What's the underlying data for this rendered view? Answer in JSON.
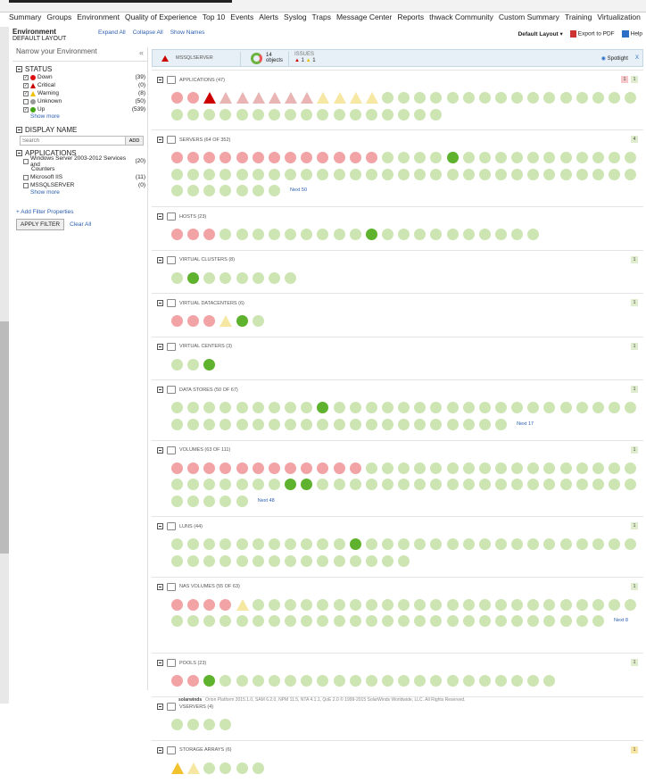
{
  "nav": [
    "Summary",
    "Groups",
    "Environment",
    "Quality of Experience",
    "Top 10",
    "Events",
    "Alerts",
    "Syslog",
    "Traps",
    "Message Center",
    "Reports",
    "thwack Community",
    "Custom Summary",
    "Training",
    "Virtualization"
  ],
  "page": {
    "title": "Environment",
    "subtitle": "DEFAULT LAYOUT",
    "expand_all": "Expand All",
    "collapse_all": "Collapse All",
    "show_names": "Show Names",
    "default_layout": "Default Layout",
    "export_pdf": "Export to PDF",
    "help": "Help"
  },
  "sidebar": {
    "narrow": "Narrow your Environment",
    "status_title": "STATUS",
    "status": [
      {
        "label": "Down",
        "count": "(39)",
        "color": "#dd1111",
        "checked": true,
        "shape": "circle"
      },
      {
        "label": "Critical",
        "count": "(0)",
        "color": "#cc0000",
        "checked": true,
        "shape": "triangle"
      },
      {
        "label": "Warning",
        "count": "(8)",
        "color": "#f0c000",
        "checked": true,
        "shape": "triangle"
      },
      {
        "label": "Unknown",
        "count": "(50)",
        "color": "#999999",
        "checked": false,
        "shape": "circle"
      },
      {
        "label": "Up",
        "count": "(539)",
        "color": "#44a414",
        "checked": true,
        "shape": "circle"
      }
    ],
    "show_more": "Show more",
    "display_name_title": "DISPLAY NAME",
    "search_placeholder": "Search",
    "search_btn": "ADD",
    "applications_title": "APPLICATIONS",
    "applications": [
      {
        "label": "Windows Server 2003-2012 Services and",
        "count": "(20)"
      },
      {
        "label": "Counters",
        "count": ""
      },
      {
        "label": "Microsoft IIS",
        "count": "(11)"
      },
      {
        "label": "MSSQLSERVER",
        "count": "(0)"
      }
    ],
    "add_filter": "+ Add Filter Properties",
    "apply": "APPLY FILTER",
    "clear": "Clear All"
  },
  "banner": {
    "node": "MSSQLSERVER",
    "objects_count": "14",
    "objects_label": "objects",
    "issues_label": "ISSUES",
    "crit_count": "1",
    "warn_count": "1",
    "spotlight": "Spotlight",
    "close": "X"
  },
  "groups": [
    {
      "title": "APPLICATIONS (47)",
      "badges": [
        "1",
        "1"
      ],
      "dots": "rrRwwwwwwyyyyggggggggggggggggggggggggggggggggg",
      "next": ""
    },
    {
      "title": "SERVERS (64 OF 352)",
      "badges": [
        "4"
      ],
      "dots": "rrrrrrrrrrrrrggggGggggggggggggggggggggggggggggggggggggggggggggggg",
      "next": "Next 50"
    },
    {
      "title": "HOSTS (23)",
      "badges": [],
      "dots": "rrrgggggggggGgggggggggg",
      "next": ""
    },
    {
      "title": "VIRTUAL CLUSTERS (8)",
      "badges": [
        "1"
      ],
      "dots": "gGgggggg",
      "next": ""
    },
    {
      "title": "VIRTUAL DATACENTERS (6)",
      "badges": [
        "1"
      ],
      "dots": "rrryGg",
      "next": ""
    },
    {
      "title": "VIRTUAL CENTERS (3)",
      "badges": [
        "1"
      ],
      "dots": "ggG",
      "next": ""
    },
    {
      "title": "DATA STORES (50 OF 67)",
      "badges": [
        "1"
      ],
      "dots": "gggggggggGgggggggggggggggggggggggggggggggggggggggg",
      "next": "Next 17"
    },
    {
      "title": "VOLUMES (63 OF 111)",
      "badges": [
        "1"
      ],
      "dots": "rrrrrrrrrrrrggggggggggggggggggggggggGGggggggggggggggggggggggggg",
      "next": "Next 48"
    },
    {
      "title": "LUNS (44)",
      "badges": [
        "1"
      ],
      "dots": "gggggggggggGgggggggggggggggggggggggggggggggg",
      "next": ""
    },
    {
      "title": "NAS VOLUMES (55 OF 63)",
      "badges": [
        "1"
      ],
      "dots": "rrrryggggggggggggggggggggggggggggggggggggggggggggggggggg",
      "next": "Next 8"
    },
    {
      "title": "POOLS (23)",
      "badges": [
        "1"
      ],
      "dots": "rrGggggggggggggggggggggg",
      "next": ""
    },
    {
      "title": "VSERVERS (4)",
      "badges": [],
      "dots": "gggg",
      "next": ""
    },
    {
      "title": "STORAGE ARRAYS (6)",
      "badges": [
        "1"
      ],
      "dots": "Yygggg",
      "next": ""
    }
  ],
  "colors": {
    "down": "#f2a3a6",
    "critical": "#e8b4b4",
    "warning": "#f6e7a3",
    "up": "#cde5b3",
    "up_strong": "#5fb22e",
    "warn_strong": "#f2c12e",
    "crit_strong": "#cc0000"
  },
  "footer": {
    "logo": "solarwinds",
    "text": "Orion Platform 2015.1.0, SAM 6.2.0, NPM 11.5, NTA 4.1.1, QoE 2.0 © 1999-2015 SolarWinds Worldwide, LLC. All Rights Reserved."
  }
}
